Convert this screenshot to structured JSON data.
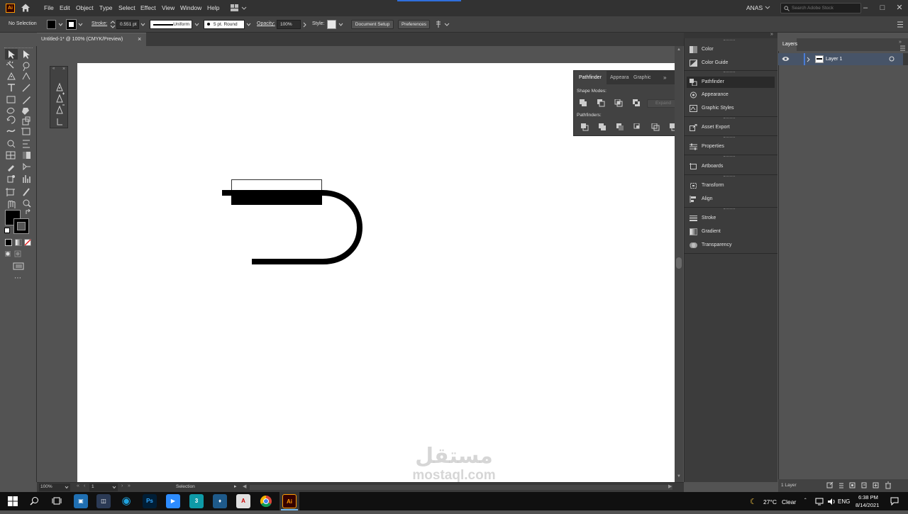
{
  "menu": {
    "items": [
      "File",
      "Edit",
      "Object",
      "Type",
      "Select",
      "Effect",
      "View",
      "Window",
      "Help"
    ],
    "app_logo": "Ai",
    "user": "ANAS",
    "search_placeholder": "Search Adobe Stock"
  },
  "control": {
    "selection": "No Selection",
    "stroke_label": "Stroke:",
    "stroke_value": "0.551 pt",
    "profile": "Uniform",
    "brush": "5 pt. Round",
    "opacity_label": "Opacity:",
    "opacity_value": "100%",
    "style_label": "Style:",
    "doc_setup": "Document Setup",
    "preferences": "Preferences"
  },
  "document": {
    "tab_title": "Untitled-1* @ 100% (CMYK/Preview)"
  },
  "pathfinder": {
    "tabs": [
      "Pathfinder",
      "Appeara",
      "Graphic"
    ],
    "shape_modes_label": "Shape Modes:",
    "pathfinders_label": "Pathfinders:",
    "expand": "Expand"
  },
  "dock": {
    "items": [
      "Color",
      "Color Guide",
      "Pathfinder",
      "Appearance",
      "Graphic Styles",
      "Asset Export",
      "Properties",
      "Artboards",
      "Transform",
      "Align",
      "Stroke",
      "Gradient",
      "Transparency"
    ]
  },
  "layers": {
    "tab": "Layers",
    "layer_name": "Layer 1",
    "count": "1 Layer"
  },
  "status": {
    "zoom": "100%",
    "artboard": "1",
    "tool": "Selection"
  },
  "taskbar": {
    "temp": "27°C",
    "weather": "Clear",
    "lang": "ENG",
    "time": "6:38 PM",
    "date": "8/14/2021"
  },
  "watermark": {
    "arabic": "مستقل",
    "latin": "mostaql.com"
  },
  "colors": {
    "accent": "#ff9a00",
    "selection": "#475468"
  }
}
